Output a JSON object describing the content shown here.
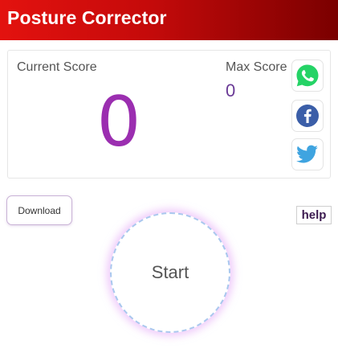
{
  "header": {
    "title": "Posture Corrector"
  },
  "score": {
    "current_label": "Current Score",
    "current_value": "0",
    "max_label": "Max Score",
    "max_value": "0"
  },
  "share": {
    "icons": [
      "whatsapp-icon",
      "facebook-icon",
      "twitter-icon"
    ]
  },
  "actions": {
    "download_label": "Download",
    "help_label": "help",
    "start_label": "Start"
  },
  "colors": {
    "header_gradient_start": "#e3120f",
    "header_gradient_end": "#7a0000",
    "current_score": "#9b2eb0",
    "max_score": "#6a3a96",
    "whatsapp": "#25d366",
    "facebook": "#3b5ea8",
    "twitter": "#3fa4e0",
    "start_glow": "#e2a0f6",
    "start_border": "#a9c8ee"
  }
}
